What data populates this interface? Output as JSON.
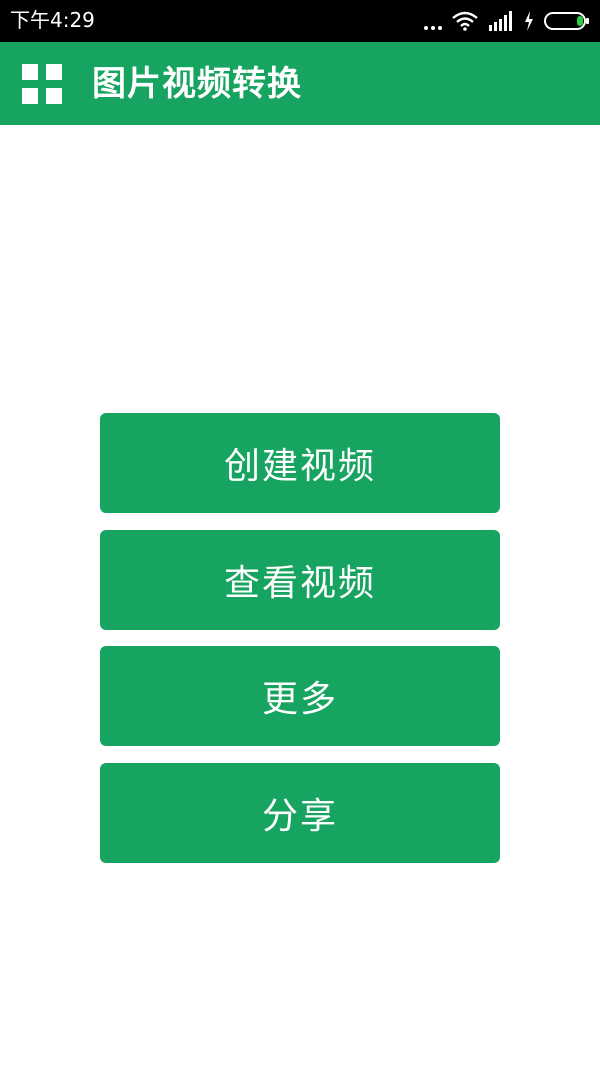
{
  "status_bar": {
    "time": "下午4:29",
    "icons": [
      "more-dots-icon",
      "wifi-icon",
      "signal-icon",
      "charging-icon",
      "battery-icon"
    ]
  },
  "app_bar": {
    "title": "图片视频转换",
    "menu_icon": "grid-menu-icon",
    "background": "#16a460"
  },
  "actions": {
    "create_video": "创建视频",
    "view_video": "查看视频",
    "more": "更多",
    "share": "分享"
  },
  "colors": {
    "accent": "#16a460",
    "status_bar": "#000000",
    "battery_level": "#2ecc40"
  }
}
